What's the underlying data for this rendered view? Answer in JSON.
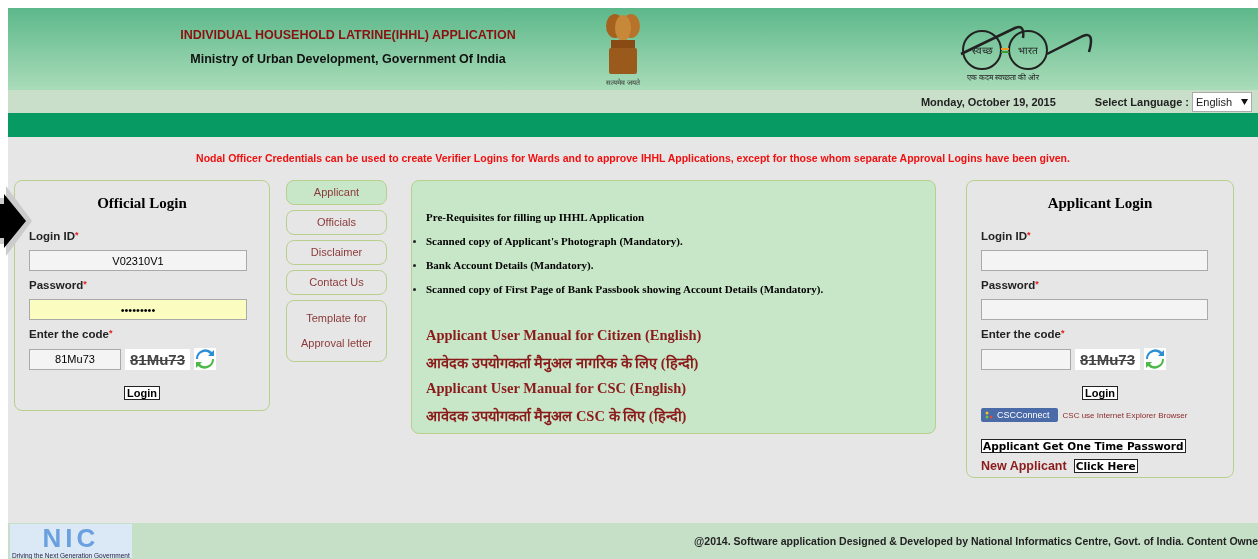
{
  "header": {
    "title": "INDIVIDUAL HOUSEHOLD LATRINE(IHHL) APPLICATION",
    "subtitle": "Ministry of Urban Development, Government Of India",
    "emblem_motto": "सत्यमेव जयते",
    "logo_words": [
      "स्वच्छ",
      "भारत"
    ],
    "logo_tagline": "एक कदम स्वच्छता की ओर"
  },
  "date": "Monday, October 19, 2015",
  "language": {
    "label": "Select Language :",
    "value": "English"
  },
  "notice": "Nodal Officer Credentials can be used to create Verifier Logins for Wards and to approve IHHL Applications, except for those whom separate Approval Logins have been given.",
  "official_login": {
    "title": "Official Login",
    "fields": [
      {
        "kind": "text",
        "label": "Login ID",
        "mark": "*",
        "value": "V02310V1",
        "autofilled": false
      },
      {
        "kind": "password",
        "label": "Password",
        "mark": "*",
        "value": "•••••••••",
        "autofilled": true
      },
      {
        "kind": "captcha",
        "label": "Enter the code",
        "mark": "*",
        "value": "81Mu73",
        "captcha": "81Mu73",
        "autofilled": false
      }
    ],
    "button": "Login"
  },
  "nav": [
    {
      "label": "Applicant",
      "selected": true
    },
    {
      "label": "Officials",
      "selected": false
    },
    {
      "label": "Disclaimer",
      "selected": false
    },
    {
      "label": "Contact Us",
      "selected": false
    },
    {
      "label": "Template for Approval letter",
      "selected": false
    }
  ],
  "info": {
    "heading": "Pre-Requisites for filling up IHHL Application",
    "items": [
      "Scanned copy of Applicant's Photograph (Mandatory).",
      "Bank Account Details (Mandatory).",
      "Scanned copy of First Page of Bank Passbook showing Account Details (Mandatory)."
    ],
    "links": [
      "Applicant User Manual for Citizen (English)",
      "आवेदक उपयोगकर्ता मैनुअल नागरिक के लिए (हिन्दी)",
      "Applicant User Manual for CSC (English)",
      "आवेदक उपयोगकर्ता मैनुअल CSC के लिए (हिन्दी)"
    ]
  },
  "applicant_login": {
    "title": "Applicant Login",
    "fields": [
      {
        "kind": "text",
        "label": "Login ID",
        "mark": "*",
        "autofilled": false
      },
      {
        "kind": "password",
        "label": "Password",
        "mark": "*",
        "autofilled": false
      },
      {
        "kind": "captcha",
        "label": "Enter the code",
        "mark": "*",
        "captcha": "81Mu73",
        "autofilled": false
      }
    ],
    "button": "Login",
    "csc_button": "CSCConnect",
    "csc_note": "CSC use Internet Explorer Browser",
    "otp_button": "Applicant Get One Time Password",
    "new_applicant": "New Applicant",
    "click_here": "Click Here"
  },
  "footer": {
    "logo": "NIC",
    "logo_tagline": "Driving the Next Generation Government",
    "copyright": "@2014. Software application Designed & Developed by National Informatics Centre, Govt. of India. Content Owne"
  }
}
